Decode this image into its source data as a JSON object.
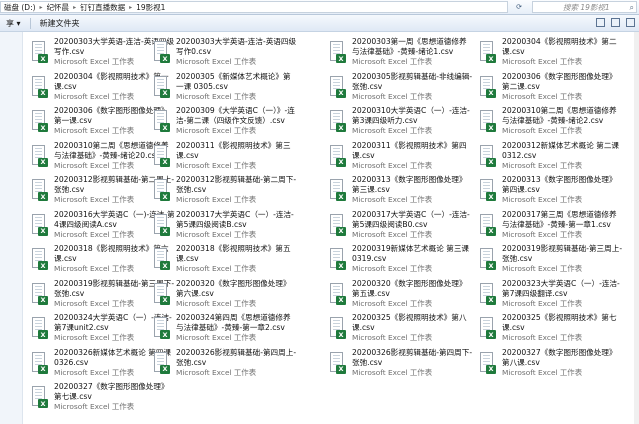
{
  "address": {
    "crumbs": [
      "磁盘 (D:)",
      "纪怀晨",
      "钉钉直播数据",
      "19影视1"
    ],
    "refresh_icon": "refresh-icon",
    "search_placeholder": "搜索 19影视1"
  },
  "toolbar": {
    "items": [
      "享 ▾",
      "新建文件夹"
    ]
  },
  "left_pane": {
    "labels": [
      "",
      "",
      "",
      "",
      "",
      "",
      "",
      "",
      "",
      "",
      "",
      ""
    ]
  },
  "file_type": "Microsoft Excel 工作表",
  "icon": "excel-csv-file-icon",
  "files": [
    "20200303大学英语-连洁-英语四级写作.csv",
    "20200303大学英语-连洁-英语四级写作0.csv",
    "20200303第一周《思想道德修养与法律基础》-黄臻-绪论1.csv",
    "20200304《影视照明技术》第二课.csv",
    "20200304《影视照明技术》第一课.csv",
    "20200305《新媒体艺术概论》第一课 0305.csv",
    "20200305影视剪辑基础-非线编辑-张弛.csv",
    "20200306《数字图形图像处理》第二课.csv",
    "20200306《数字图形图像处理》第一课.csv",
    "20200309《大学英语C（一）》-连洁-第二课（四级作文反馈）.csv",
    "20200310大学英语C（一）-连洁-第3课四级听力.csv",
    "20200310第二周《思想道德修养与法律基础》-黄臻-绪论2.csv",
    "20200310第二周《思想道德修养与法律基础》-黄臻-绪论20.csv",
    "20200311《影视照明技术》第三课.csv",
    "20200311《影视照明技术》第四课.csv",
    "20200312新媒体艺术概论 第二课 0312.csv",
    "20200312影视剪辑基础-第二周上-张弛.csv",
    "20200312影视剪辑基础-第二周下-张弛.csv",
    "20200313《数字图形图像处理》第三课.csv",
    "20200313《数字图形图像处理》第四课.csv",
    "20200316大学英语C（一)-连洁-第4课四级阅读A.csv",
    "20200317大学英语C（一）-连洁-第5课四级阅读B.csv",
    "20200317大学英语C（一）-连洁-第5课四级阅读B0.csv",
    "20200317第三周《思想道德修养与法律基础》-黄臻-第一章1.csv",
    "20200318《影视照明技术》第六课.csv",
    "20200318《影视照明技术》第五课.csv",
    "20200319新媒体艺术概论 第三课 0319.csv",
    "20200319影视剪辑基础-第三周上-张弛.csv",
    "20200319影视剪辑基础-第三周下-张弛.csv",
    "20200320《数字图形图像处理》第六课.csv",
    "20200320《数字图形图像处理》第五课.csv",
    "20200323大学英语C（一）-连洁-第7课四级翻译.csv",
    "20200324大学英语C（一）-连洁-第7课unit2.csv",
    "20200324第四周《思想道德修养与法律基础》-黄臻-第一章2.csv",
    "20200325《影视照明技术》第八课.csv",
    "20200325《影视照明技术》第七课.csv",
    "20200326新媒体艺术概论 第四课 0326.csv",
    "20200326影视剪辑基础-第四周上-张弛.csv",
    "20200326影视剪辑基础-第四周下-张弛.csv",
    "20200327《数字图形图像处理》第八课.csv",
    "20200327《数字图形图像处理》第七课.csv"
  ]
}
